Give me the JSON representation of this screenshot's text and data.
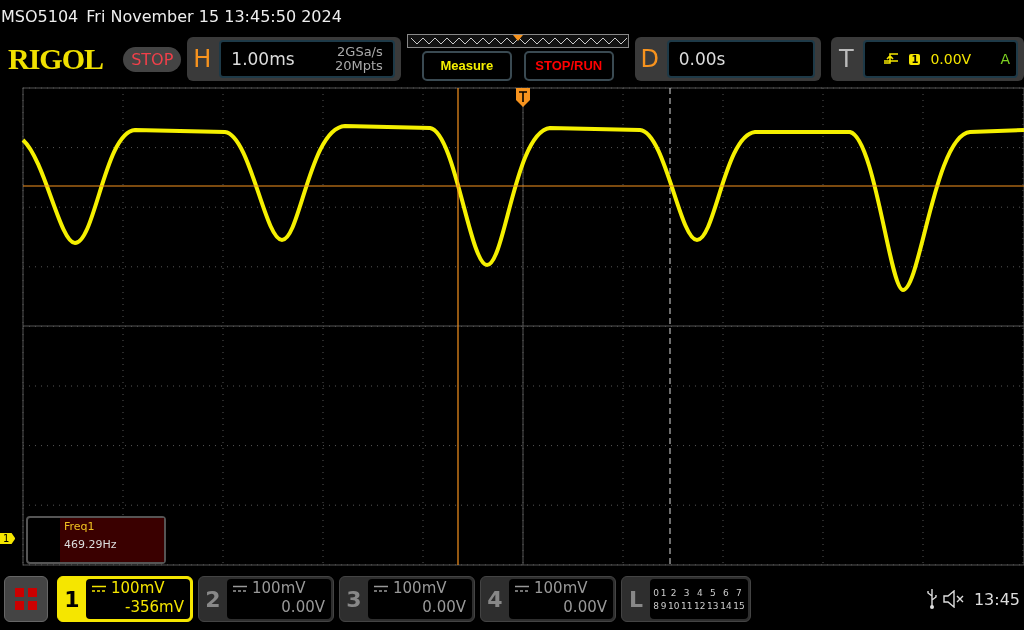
{
  "status_bar": {
    "model": "MSO5104",
    "datetime": "Fri November 15 13:45:50 2024"
  },
  "logo": "RIGOL",
  "run_state": "STOP",
  "horizontal": {
    "label": "H",
    "timebase": "1.00ms",
    "sample_rate": "2GSa/s",
    "memory_depth": "20Mpts"
  },
  "buttons": [
    "Measure",
    "STOP/RUN"
  ],
  "delay": {
    "label": "D",
    "value": "0.00s"
  },
  "trigger": {
    "label": "T",
    "source": "1",
    "level": "0.00V",
    "mode": "A"
  },
  "channel_marker": "1",
  "measurement": {
    "name": "Freq1",
    "value": "469.29Hz"
  },
  "channels": [
    {
      "number": "1",
      "scale": "100mV",
      "offset": "-356mV",
      "selected": true
    },
    {
      "number": "2",
      "scale": "100mV",
      "offset": "0.00V",
      "selected": false
    },
    {
      "number": "3",
      "scale": "100mV",
      "offset": "0.00V",
      "selected": false
    },
    {
      "number": "4",
      "scale": "100mV",
      "offset": "0.00V",
      "selected": false
    }
  ],
  "logic": {
    "label": "L",
    "bits": [
      "0",
      "1",
      "2",
      "3",
      "4",
      "5",
      "6",
      "7",
      "8",
      "9",
      "10",
      "11",
      "12",
      "13",
      "14",
      "15"
    ]
  },
  "clock": "13:45"
}
